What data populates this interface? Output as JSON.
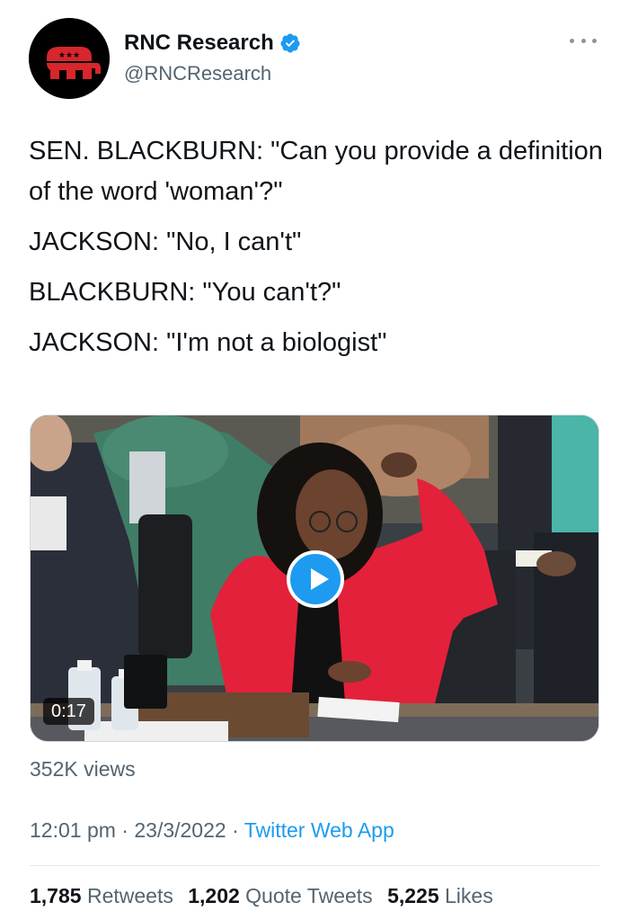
{
  "author": {
    "display_name": "RNC Research",
    "handle": "@RNCResearch",
    "avatar_icon": "gop-elephant-logo",
    "verified_icon": "verified-badge-icon"
  },
  "tweet": {
    "lines": [
      "SEN. BLACKBURN: \"Can you provide a definition of the word 'woman'?\"",
      "JACKSON: \"No, I can't\"",
      "BLACKBURN: \"You can't?\"",
      "JACKSON: \"I'm not a biologist\""
    ]
  },
  "media": {
    "duration": "0:17",
    "views": "352K views",
    "play_icon": "play-icon"
  },
  "meta": {
    "time": "12:01 pm",
    "separator": " · ",
    "date": "23/3/2022",
    "source": "Twitter Web App"
  },
  "stats": {
    "retweets_count": "1,785",
    "retweets_label": "Retweets",
    "quotes_count": "1,202",
    "quotes_label": "Quote Tweets",
    "likes_count": "5,225",
    "likes_label": "Likes"
  },
  "colors": {
    "accent": "#1d9bf0",
    "secondary_text": "#536471",
    "primary_text": "#0f1419",
    "logo_red": "#d7262c"
  }
}
